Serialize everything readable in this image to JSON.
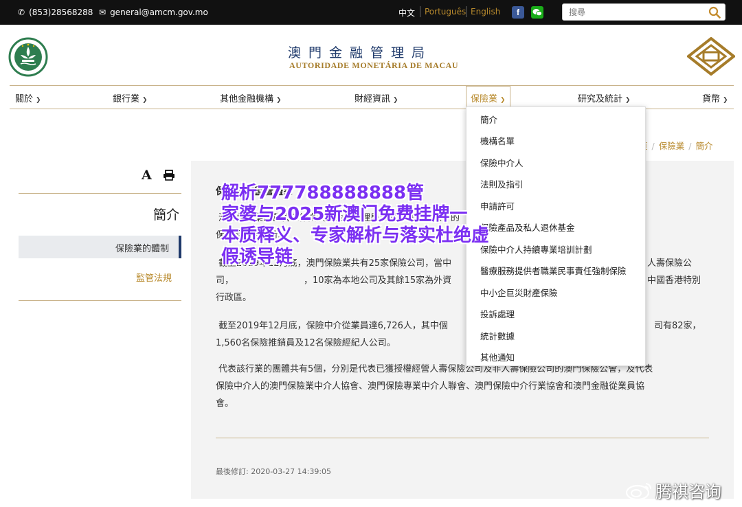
{
  "topbar": {
    "phone": "(853)28568288",
    "email": "general@amcm.gov.mo",
    "lang_zh": "中文",
    "lang_pt": "Português",
    "lang_en": "English",
    "search_placeholder": "搜尋",
    "colors": {
      "bg": "#111111",
      "active_lang": "#b88a2d",
      "facebook": "#3b5998",
      "wechat": "#1aad19"
    }
  },
  "header": {
    "title_cn": "澳門金融管理局",
    "title_pt": "AUTORIDADE MONETÁRIA DE MACAU"
  },
  "nav": {
    "items": [
      "關於",
      "銀行業",
      "其他金融機構",
      "財經資訊",
      "保險業",
      "研究及統計",
      "貨幣"
    ],
    "active": "保險業"
  },
  "dropdown": {
    "items": [
      "簡介",
      "機構名單",
      "保險中介人",
      "法則及指引",
      "申請許可",
      "保險產品及私人退休基金",
      "保險中介人持續專業培訓計劃",
      "醫療服務提供者職業民事責任強制保險",
      "中小企巨災財產保險",
      "投訴處理",
      "統計數據",
      "其他通知"
    ]
  },
  "breadcrumb": {
    "home": "頁",
    "section": "保險業",
    "current": "簡介"
  },
  "sidebar": {
    "title": "簡介",
    "items": [
      "保險業的體制",
      "監管法規"
    ]
  },
  "content": {
    "heading": "保險業的監管體系",
    "p1_line1": "澳門保險業的監管工作由澳門金融管理局負責。管理局核下的",
    "p1_line2": "保險監察廳執行。",
    "p2_line1": "截至2019年12月底，澳門保險業共有25家保險公司，當中",
    "p2_line1b": "人壽保險公",
    "p2_line2": "司，",
    "p2_line2b": "，10家為本地公司及其餘15家為外資",
    "p2_line2c": "中國香港特別",
    "p2_line3": "行政區。",
    "p3_line1": "截至2019年12月底，保險中介從業員達6,726人，其中個",
    "p3_line1b": "司有82家，",
    "p3_line2": "1,560名保險推銷員及12名保險經紀人公司。",
    "p4_line1": "代表該行業的團體共有5個，分別是代表已獲授權經營人壽保險公司及非人壽保險公司的澳門保險公會，及代表",
    "p4_line2": "保險中介人的澳門保險業中介人協會、澳門保險專業中介人聯會、澳門保險中介行業協會和澳門金融從業員協",
    "p4_line3": "會。",
    "last_modified": "最後修訂: 2020-03-27 14:39:05"
  },
  "overlay": {
    "line1": "解析777788888888管",
    "line2": "家婆与2025新澳门免费挂牌一",
    "line3": "本质释义、专家解析与落实杜绝虚",
    "line4": "假诱导链",
    "color": "#7b2ff2"
  },
  "watermark": {
    "text": "腾祺咨询"
  }
}
